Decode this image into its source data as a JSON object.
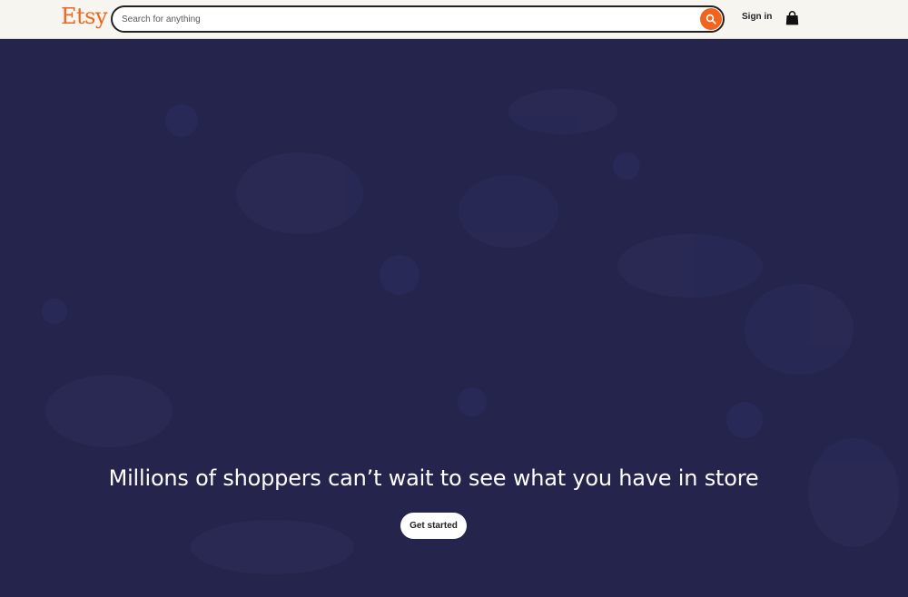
{
  "header": {
    "logo": "Etsy",
    "search": {
      "placeholder": "Search for anything",
      "value": ""
    },
    "sign_in_label": "Sign in"
  },
  "hero": {
    "headline": "Millions of shoppers can’t wait to see what you have in store",
    "cta_label": "Get started"
  },
  "colors": {
    "brand_orange": "#f1641e",
    "hero_background": "#24244d",
    "header_background": "#f7f5f0"
  },
  "icons": {
    "search": "search-icon",
    "bag": "shopping-bag-icon"
  }
}
